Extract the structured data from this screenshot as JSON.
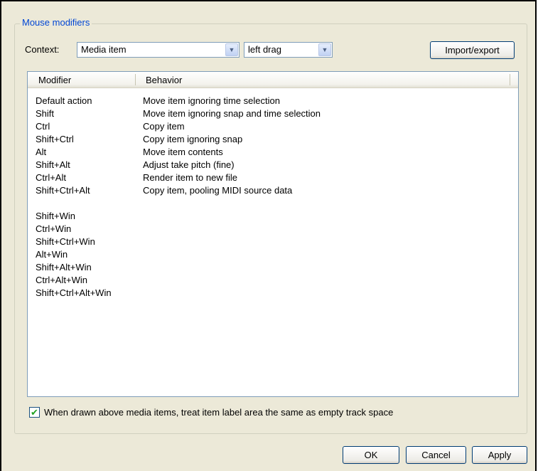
{
  "group": {
    "title": "Mouse modifiers"
  },
  "context": {
    "label": "Context:",
    "selected": "Media item",
    "action_selected": "left drag"
  },
  "import_export_label": "Import/export",
  "list": {
    "columns": [
      "Modifier",
      "Behavior"
    ],
    "rows": [
      {
        "modifier": "Default action",
        "behavior": "Move item ignoring time selection"
      },
      {
        "modifier": "Shift",
        "behavior": "Move item ignoring snap and time selection"
      },
      {
        "modifier": "Ctrl",
        "behavior": "Copy item"
      },
      {
        "modifier": "Shift+Ctrl",
        "behavior": "Copy item ignoring snap"
      },
      {
        "modifier": "Alt",
        "behavior": "Move item contents"
      },
      {
        "modifier": "Shift+Alt",
        "behavior": "Adjust take pitch (fine)"
      },
      {
        "modifier": "Ctrl+Alt",
        "behavior": "Render item to new file"
      },
      {
        "modifier": "Shift+Ctrl+Alt",
        "behavior": "Copy item, pooling MIDI source data"
      },
      {
        "modifier": "",
        "behavior": ""
      },
      {
        "modifier": "Shift+Win",
        "behavior": ""
      },
      {
        "modifier": "Ctrl+Win",
        "behavior": ""
      },
      {
        "modifier": "Shift+Ctrl+Win",
        "behavior": ""
      },
      {
        "modifier": "Alt+Win",
        "behavior": ""
      },
      {
        "modifier": "Shift+Alt+Win",
        "behavior": ""
      },
      {
        "modifier": "Ctrl+Alt+Win",
        "behavior": ""
      },
      {
        "modifier": "Shift+Ctrl+Alt+Win",
        "behavior": ""
      }
    ]
  },
  "checkbox": {
    "checked": true,
    "label": "When drawn above media items, treat item label area the same as empty track space"
  },
  "buttons": {
    "ok": "OK",
    "cancel": "Cancel",
    "apply": "Apply"
  },
  "icons": {
    "dropdown": "chevron-down-icon",
    "check": "checkmark-icon"
  },
  "colors": {
    "legend": "#0046d5",
    "dialog_bg": "#ece9d8",
    "check": "#21a121"
  }
}
